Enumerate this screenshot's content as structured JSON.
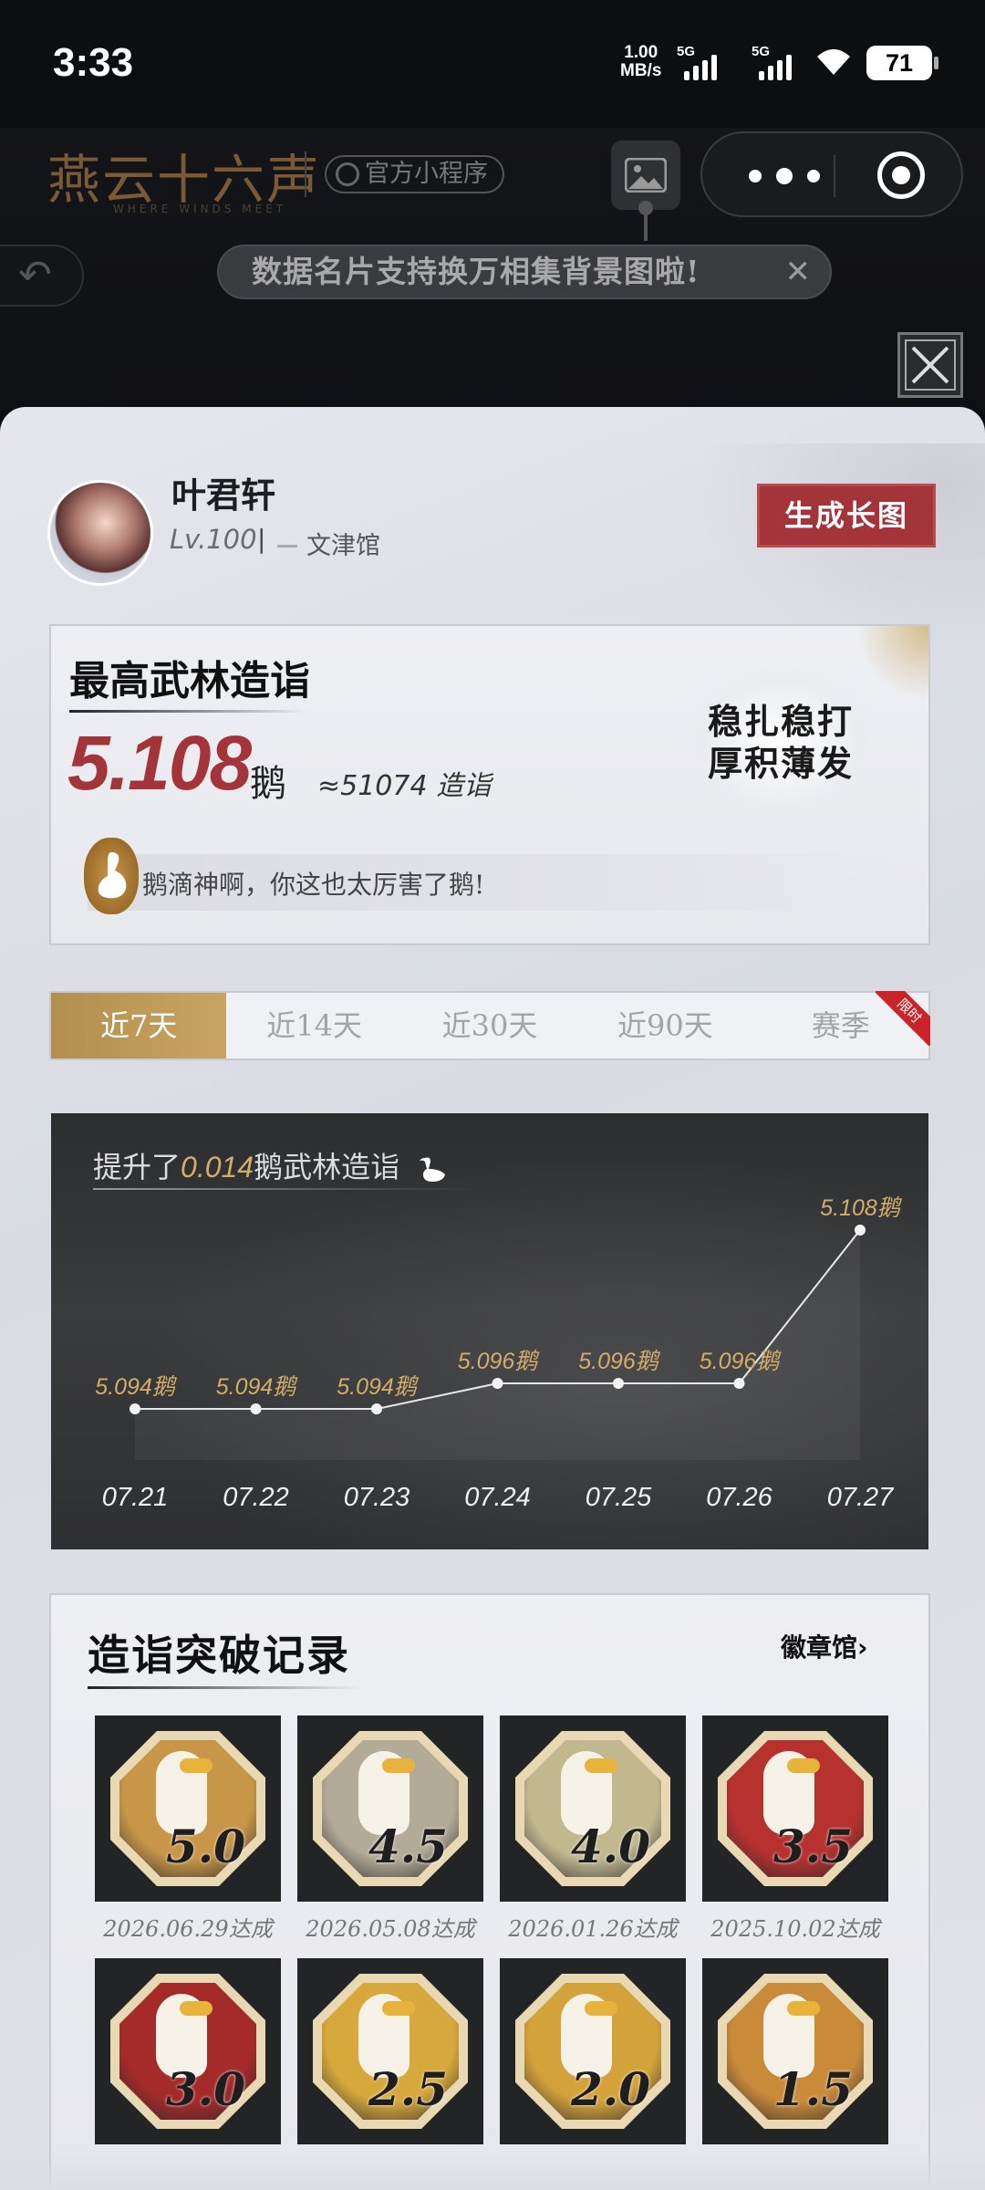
{
  "status_bar": {
    "time": "3:33",
    "net_speed": "1.00",
    "net_unit": "MB/s",
    "sim1": "5G",
    "sim2": "5G",
    "battery": "71"
  },
  "mini_program": {
    "logo_text": "燕云十六声",
    "logo_sub": "WHERE WINDS MEET",
    "tag": "官方小程序",
    "banner_text": "数据名片支持换万相集背景图啦!",
    "banner_close": "✕"
  },
  "profile": {
    "name": "叶君轩",
    "level": "Lv.100",
    "separator": "|",
    "guild": "文津馆",
    "generate_button": "生成长图"
  },
  "score": {
    "title": "最高武林造诣",
    "value": "5.108",
    "unit": "鹅",
    "approx": "≈51074 造诣",
    "seal_line1": "稳扎稳打",
    "seal_line2": "厚积薄发",
    "quote": "鹅滴神啊，你这也太厉害了鹅!"
  },
  "tabs": [
    {
      "label": "近7天",
      "active": true
    },
    {
      "label": "近14天",
      "active": false
    },
    {
      "label": "近30天",
      "active": false
    },
    {
      "label": "近90天",
      "active": false
    },
    {
      "label": "赛季",
      "active": false,
      "ribbon": "限时"
    }
  ],
  "chart_headline": {
    "prefix": "提升了",
    "amount": "0.014",
    "suffix": "鹅武林造诣"
  },
  "chart_data": {
    "type": "line",
    "categories": [
      "07.21",
      "07.22",
      "07.23",
      "07.24",
      "07.25",
      "07.26",
      "07.27"
    ],
    "values": [
      5.094,
      5.094,
      5.094,
      5.096,
      5.096,
      5.096,
      5.108
    ],
    "data_labels": [
      "5.094鹅",
      "5.094鹅",
      "5.094鹅",
      "5.096鹅",
      "5.096鹅",
      "5.096鹅",
      "5.108鹅"
    ],
    "title": "",
    "xlabel": "",
    "ylabel": "",
    "line_color": "#e8e8e8",
    "label_color": "#d3ad6a",
    "grid": false
  },
  "records": {
    "title": "造诣突破记录",
    "hall_link": "徽章馆",
    "badges": [
      {
        "value": "5.0",
        "date": "2026.06.29达成",
        "color": "#c79648"
      },
      {
        "value": "4.5",
        "date": "2026.05.08达成",
        "color": "#b4aa98"
      },
      {
        "value": "4.0",
        "date": "2026.01.26达成",
        "color": "#c2b890"
      },
      {
        "value": "3.5",
        "date": "2025.10.02达成",
        "color": "#b7312f"
      },
      {
        "value": "3.0",
        "date": "",
        "color": "#a52a2a"
      },
      {
        "value": "2.5",
        "date": "",
        "color": "#d7a83c"
      },
      {
        "value": "2.0",
        "date": "",
        "color": "#d4a23a"
      },
      {
        "value": "1.5",
        "date": "",
        "color": "#c98a3a"
      }
    ]
  }
}
